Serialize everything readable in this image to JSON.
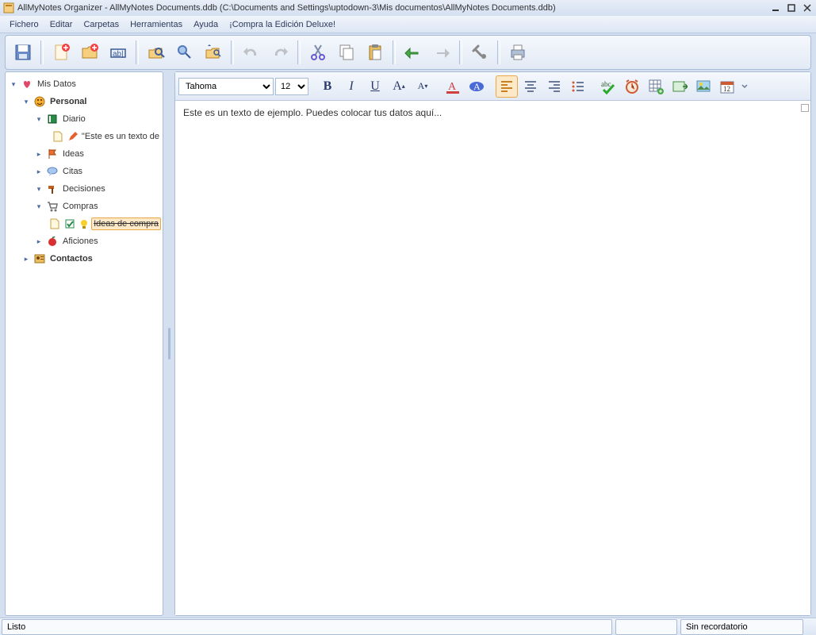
{
  "window": {
    "title": "AllMyNotes Organizer - AllMyNotes Documents.ddb (C:\\Documents and Settings\\uptodown-3\\Mis documentos\\AllMyNotes Documents.ddb)"
  },
  "menu": {
    "fichero": "Fichero",
    "editar": "Editar",
    "carpetas": "Carpetas",
    "herramientas": "Herramientas",
    "ayuda": "Ayuda",
    "promo": "¡Compra la Edición Deluxe!"
  },
  "tree": {
    "root": "Mis Datos",
    "personal": "Personal",
    "diario": "Diario",
    "diario_note": "\"Este es un texto de",
    "ideas": "Ideas",
    "citas": "Citas",
    "decisiones": "Decisiones",
    "compras": "Compras",
    "compras_note": "Ideas de compra",
    "aficiones": "Aficiones",
    "contactos": "Contactos"
  },
  "format": {
    "font": "Tahoma",
    "size": "12"
  },
  "editor": {
    "content": "Este es un texto de ejemplo. Puedes colocar tus datos aquí..."
  },
  "status": {
    "left": "Listo",
    "mid": "",
    "right": "Sin recordatorio"
  }
}
